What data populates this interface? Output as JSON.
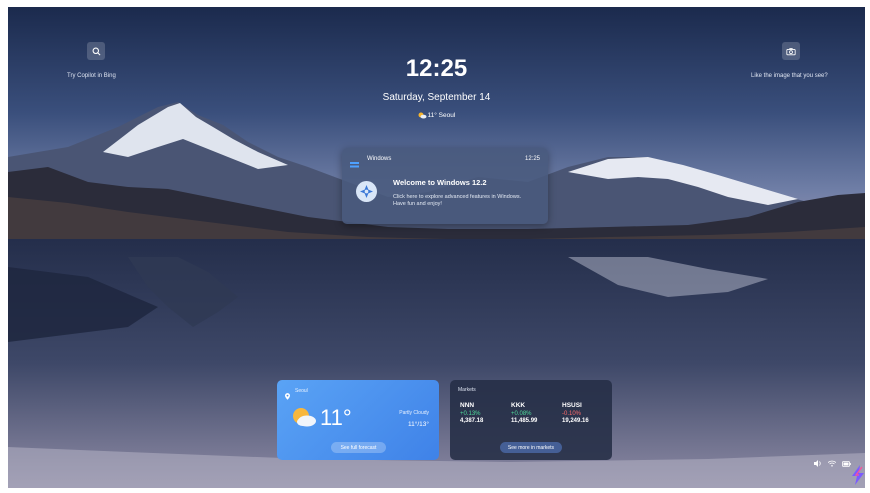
{
  "topbar": {
    "left_label": "Try Copilot in Bing",
    "right_label": "Like the image that you see?",
    "left_icon": "search-icon",
    "right_icon": "camera-icon"
  },
  "clock": {
    "time": "12:25",
    "date": "Saturday, September 14",
    "weather": "11° Seoul"
  },
  "notification": {
    "app": "Windows",
    "time": "12:25",
    "title": "Welcome to Windows 12.2",
    "body": "Click here to explore advanced features in Windows. Have fun and enjoy!",
    "icon": "windows-logo-icon"
  },
  "weather_card": {
    "location": "Seoul",
    "temperature": "11°",
    "condition": "Partly Cloudy",
    "range": "11°/13°",
    "button": "See full forecast"
  },
  "markets_card": {
    "title": "Markets",
    "items": [
      {
        "symbol": "NNN",
        "change": "+0.13%",
        "value": "4,387.18"
      },
      {
        "symbol": "KKK",
        "change": "+0.08%",
        "value": "11,485.99"
      },
      {
        "symbol": "HSUSI",
        "change": "-0.10%",
        "value": "19,249.16"
      }
    ],
    "button": "See more in markets"
  },
  "colors": {
    "positive": "#4fd99a",
    "negative": "#ff6b6b",
    "weather_card": "#4a90ec"
  }
}
